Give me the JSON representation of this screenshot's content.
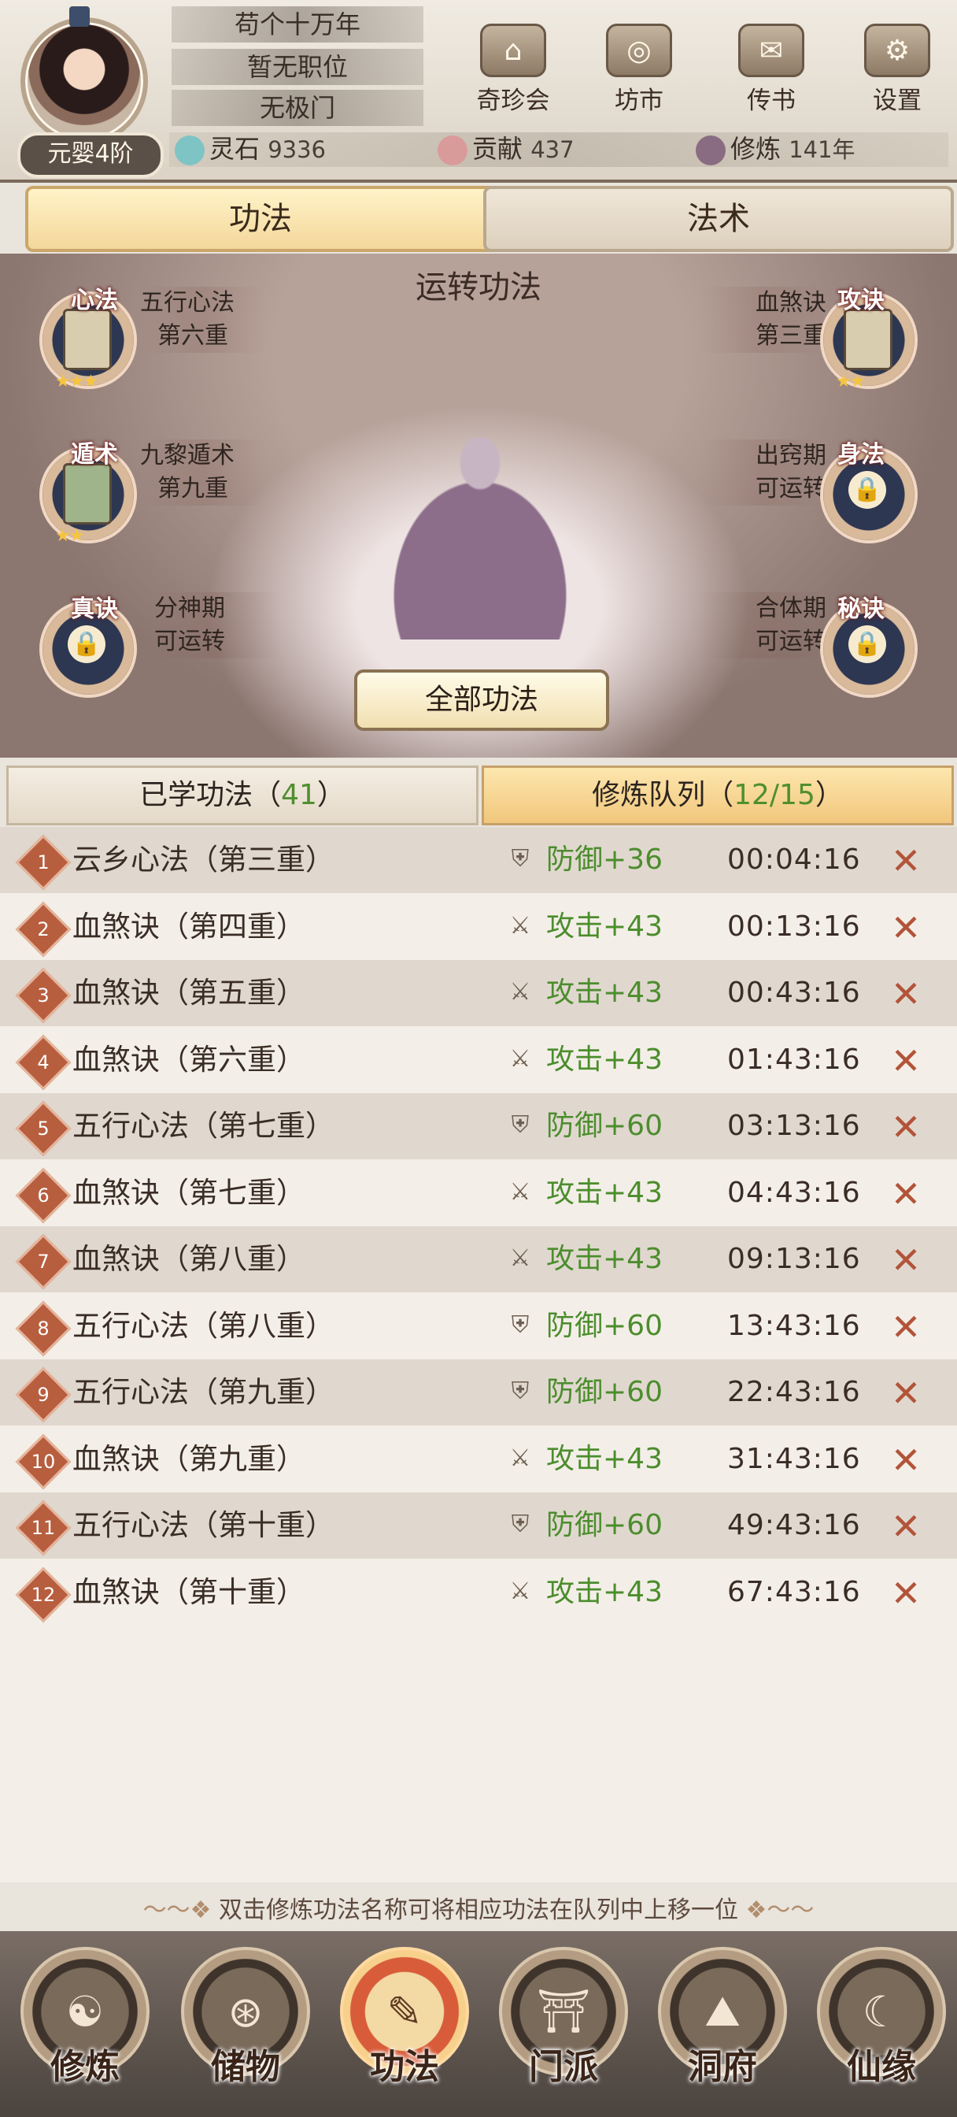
{
  "profile": {
    "title": "苟个十万年",
    "position": "暂无职位",
    "sect": "无极门",
    "realm": "元婴4阶"
  },
  "nav": [
    {
      "label": "奇珍会",
      "icon": "pavilion-icon"
    },
    {
      "label": "坊市",
      "icon": "market-icon"
    },
    {
      "label": "传书",
      "icon": "scroll-icon"
    },
    {
      "label": "设置",
      "icon": "gear-icon"
    }
  ],
  "resources": {
    "spirit_stone_label": "灵石",
    "spirit_stone_value": "9336",
    "contribution_label": "贡献",
    "contribution_value": "437",
    "cultivation_label": "修炼",
    "cultivation_value": "141年"
  },
  "main_tabs": [
    "功法",
    "法术"
  ],
  "stage": {
    "title": "运转功法",
    "slots": [
      {
        "tag": "心法",
        "line1": "五行心法",
        "line2": "第六重",
        "stars": "★★★",
        "state": "book"
      },
      {
        "tag": "遁术",
        "line1": "九黎遁术",
        "line2": "第九重",
        "stars": "★★",
        "state": "book"
      },
      {
        "tag": "真诀",
        "line1": "分神期",
        "line2": "可运转",
        "stars": "",
        "state": "locked"
      },
      {
        "tag": "攻诀",
        "line1": "血煞诀",
        "line2": "第三重",
        "stars": "★★",
        "state": "book"
      },
      {
        "tag": "身法",
        "line1": "出窍期",
        "line2": "可运转",
        "stars": "",
        "state": "locked"
      },
      {
        "tag": "秘诀",
        "line1": "合体期",
        "line2": "可运转",
        "stars": "",
        "state": "locked"
      }
    ],
    "all_button": "全部功法"
  },
  "sub_tabs": {
    "learned_label": "已学功法（",
    "learned_count": "41",
    "learned_close": "）",
    "queue_label": "修炼队列（",
    "queue_count": "12/15",
    "queue_close": "）"
  },
  "queue": [
    {
      "index": "1",
      "name": "云乡心法（第三重）",
      "effect": "防御+36",
      "type": "defense",
      "time": "00:04:16"
    },
    {
      "index": "2",
      "name": "血煞诀（第四重）",
      "effect": "攻击+43",
      "type": "attack",
      "time": "00:13:16"
    },
    {
      "index": "3",
      "name": "血煞诀（第五重）",
      "effect": "攻击+43",
      "type": "attack",
      "time": "00:43:16"
    },
    {
      "index": "4",
      "name": "血煞诀（第六重）",
      "effect": "攻击+43",
      "type": "attack",
      "time": "01:43:16"
    },
    {
      "index": "5",
      "name": "五行心法（第七重）",
      "effect": "防御+60",
      "type": "defense",
      "time": "03:13:16"
    },
    {
      "index": "6",
      "name": "血煞诀（第七重）",
      "effect": "攻击+43",
      "type": "attack",
      "time": "04:43:16"
    },
    {
      "index": "7",
      "name": "血煞诀（第八重）",
      "effect": "攻击+43",
      "type": "attack",
      "time": "09:13:16"
    },
    {
      "index": "8",
      "name": "五行心法（第八重）",
      "effect": "防御+60",
      "type": "defense",
      "time": "13:43:16"
    },
    {
      "index": "9",
      "name": "五行心法（第九重）",
      "effect": "防御+60",
      "type": "defense",
      "time": "22:43:16"
    },
    {
      "index": "10",
      "name": "血煞诀（第九重）",
      "effect": "攻击+43",
      "type": "attack",
      "time": "31:43:16"
    },
    {
      "index": "11",
      "name": "五行心法（第十重）",
      "effect": "防御+60",
      "type": "defense",
      "time": "49:43:16"
    },
    {
      "index": "12",
      "name": "血煞诀（第十重）",
      "effect": "攻击+43",
      "type": "attack",
      "time": "67:43:16"
    }
  ],
  "hint": "双击修炼功法名称可将相应功法在队列中上移一位",
  "bottom_nav": [
    {
      "label": "修炼",
      "icon": "meditate-icon"
    },
    {
      "label": "储物",
      "icon": "bag-icon"
    },
    {
      "label": "功法",
      "icon": "manual-icon",
      "active": true
    },
    {
      "label": "门派",
      "icon": "sect-gate-icon"
    },
    {
      "label": "洞府",
      "icon": "cave-icon"
    },
    {
      "label": "仙缘",
      "icon": "destiny-icon"
    }
  ],
  "colors": {
    "accent_green": "#4c8d2d",
    "index_red": "#b75e3f",
    "delete_red": "#b2543a"
  }
}
